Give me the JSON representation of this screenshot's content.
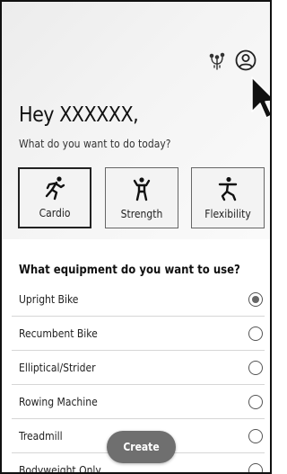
{
  "header": {
    "hub_icon": "device-hub-icon",
    "profile_icon": "account-circle-icon"
  },
  "greeting": {
    "title": "Hey XXXXXX,",
    "subtitle": "What do you want to do today?"
  },
  "workout_types": [
    {
      "label": "Cardio",
      "icon": "running-icon",
      "selected": true
    },
    {
      "label": "Strength",
      "icon": "strength-icon",
      "selected": false
    },
    {
      "label": "Flexibility",
      "icon": "stretching-icon",
      "selected": false
    }
  ],
  "equipment": {
    "title": "What equipment do you want to use?",
    "options": [
      {
        "label": "Upright Bike",
        "selected": true
      },
      {
        "label": "Recumbent Bike",
        "selected": false
      },
      {
        "label": "Elliptical/Strider",
        "selected": false
      },
      {
        "label": "Rowing Machine",
        "selected": false
      },
      {
        "label": "Treadmill",
        "selected": false
      },
      {
        "label": "Bodyweight Only",
        "selected": false
      }
    ]
  },
  "create_button": {
    "label": "Create"
  },
  "colors": {
    "button_bg": "#6f6f6f",
    "border": "#111111",
    "divider": "#d6d6d6"
  }
}
